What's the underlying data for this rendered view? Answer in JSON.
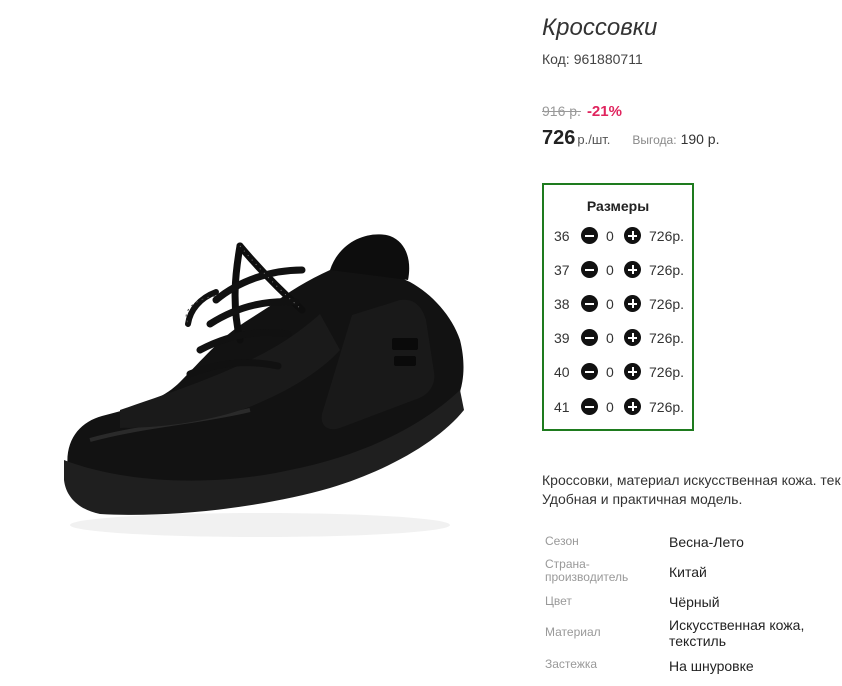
{
  "product": {
    "title": "Кроссовки",
    "code_label": "Код:",
    "code_value": "961880711"
  },
  "price": {
    "old": "916 р.",
    "discount": "-21%",
    "current": "726",
    "unit": "р./шт.",
    "saving_label": "Выгода:",
    "saving_value": "190 р."
  },
  "sizes": {
    "title": "Размеры",
    "items": [
      {
        "size": "36",
        "qty": "0",
        "price": "726р."
      },
      {
        "size": "37",
        "qty": "0",
        "price": "726р."
      },
      {
        "size": "38",
        "qty": "0",
        "price": "726р."
      },
      {
        "size": "39",
        "qty": "0",
        "price": "726р."
      },
      {
        "size": "40",
        "qty": "0",
        "price": "726р."
      },
      {
        "size": "41",
        "qty": "0",
        "price": "726р."
      }
    ]
  },
  "description": {
    "line1": "Кроссовки, материал искусственная кожа. тек",
    "line2": "Удобная и практичная модель."
  },
  "attributes": [
    {
      "label": "Сезон",
      "value": "Весна-Лето"
    },
    {
      "label": "Страна-производитель",
      "value": "Китай"
    },
    {
      "label": "Цвет",
      "value": "Чёрный"
    },
    {
      "label": "Материал",
      "value": "Искусственная кожа, текстиль"
    },
    {
      "label": "Застежка",
      "value": "На шнуровке"
    }
  ],
  "colors": {
    "discount": "#e0245e",
    "sizes_border": "#1e7b1e"
  }
}
